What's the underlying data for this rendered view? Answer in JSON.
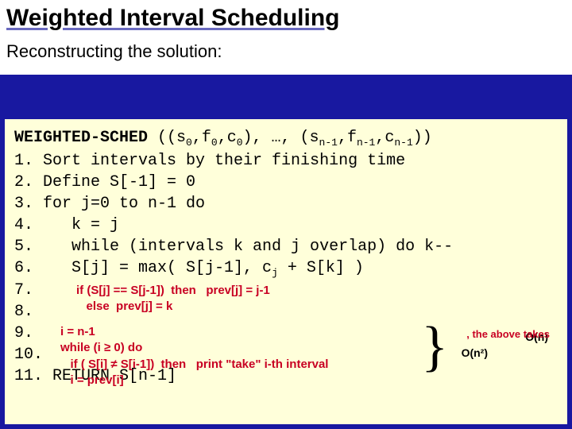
{
  "title": "Weighted Interval Scheduling",
  "subtitle": "Reconstructing the solution:",
  "func": "WEIGHTED-SCHED",
  "sig_open": " ((s",
  "sig_z0": "0",
  "sig_f": ",f",
  "sig_c": ",c",
  "sig_mid": "), …, (s",
  "sig_nm1": "n-1",
  "sig_fn": ",f",
  "sig_cn": ",c",
  "sig_close": "))",
  "line1": "1. Sort intervals by their finishing time",
  "line2": "2. Define S[-1] = 0",
  "line3": "3. for j=0 to n-1 do",
  "line4": "4.    k = j",
  "line5": "5.    while (intervals k and j overlap) do k--",
  "line6_a": "6.    S[j] = max( S[j-1], c",
  "line6_j": "j",
  "line6_b": " + S[k] )",
  "line7": "7.",
  "line8": "8.",
  "line9": "9.",
  "line10": "10.",
  "line11": "11. RETURN S[n-1]",
  "hw_if": "if (S[j] == S[j-1])  then   prev[j] = j-1",
  "hw_else": "   else  prev[j] = k",
  "hw_init": "i = n-1",
  "hw_while": "while (i ≥ 0) do",
  "hw_cond": "   if ( S[i] ≠ S[i-1])  then   print \"take\" i-th interval",
  "hw_step": "   i = prev[i]",
  "note_on": "O(n)",
  "note_on2": "O(n²)",
  "note_above": ", the above takes"
}
